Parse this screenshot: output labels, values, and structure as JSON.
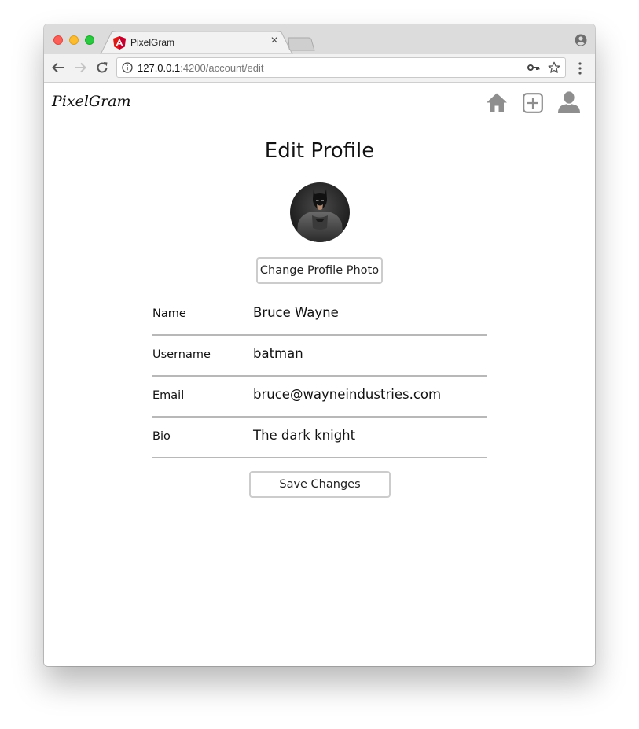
{
  "browser": {
    "tab_title": "PixelGram",
    "tab_close": "×",
    "url_host": "127.0.0.1",
    "url_path": ":4200/account/edit",
    "icons": {
      "favicon": "angular-logo-icon",
      "back": "back-arrow-icon",
      "forward": "forward-arrow-icon",
      "reload": "reload-icon",
      "info": "info-icon",
      "key": "key-icon",
      "star": "star-icon",
      "menu": "vertical-dots-icon",
      "profile": "profile-circle-icon"
    }
  },
  "header": {
    "brand": "PixelGram",
    "icons": [
      "home-icon",
      "add-post-icon",
      "user-icon"
    ]
  },
  "main": {
    "title": "Edit Profile",
    "change_photo_label": "Change Profile Photo",
    "fields": [
      {
        "label": "Name",
        "value": "Bruce Wayne"
      },
      {
        "label": "Username",
        "value": "batman"
      },
      {
        "label": "Email",
        "value": "bruce@wayneindustries.com"
      },
      {
        "label": "Bio",
        "value": "The dark knight"
      }
    ],
    "save_label": "Save Changes"
  },
  "colors": {
    "chrome_bg": "#dcdcdc",
    "toolbar_bg": "#f2f2f2",
    "icon_gray": "#8e8e8e",
    "button_border": "#cccccc",
    "field_underline": "#b8b8b8",
    "angular_red": "#dd1b16"
  }
}
